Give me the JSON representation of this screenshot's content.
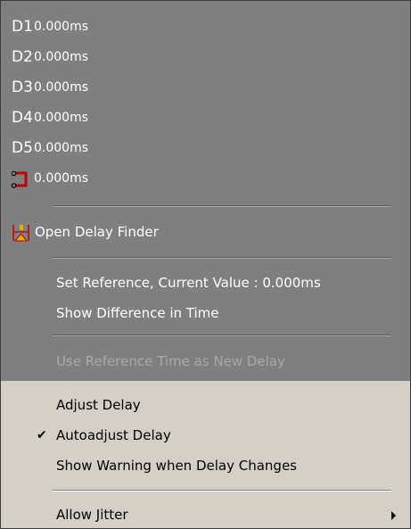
{
  "delays": [
    {
      "label": "D1",
      "value": "0.000ms"
    },
    {
      "label": "D2",
      "value": "0.000ms"
    },
    {
      "label": "D3",
      "value": "0.000ms"
    },
    {
      "label": "D4",
      "value": "0.000ms"
    },
    {
      "label": "D5",
      "value": "0.000ms"
    }
  ],
  "reference_icon": "reference-bracket-icon",
  "reference_value": "0.000ms",
  "finder": {
    "icon": "delay-finder-icon",
    "label": "Open Delay Finder"
  },
  "set_reference": "Set Reference, Current Value : 0.000ms",
  "show_difference": "Show Difference in Time",
  "use_reference": "Use Reference Time as New Delay",
  "adjust_delay": "Adjust Delay",
  "autoadjust": {
    "label": "Autoadjust Delay",
    "checked": true
  },
  "show_warning": "Show Warning when Delay Changes",
  "allow_jitter": "Allow Jitter",
  "colors": {
    "dark_bg": "#7f7f7f",
    "light_bg": "#d4d0c8",
    "icon_red": "#c00000"
  }
}
